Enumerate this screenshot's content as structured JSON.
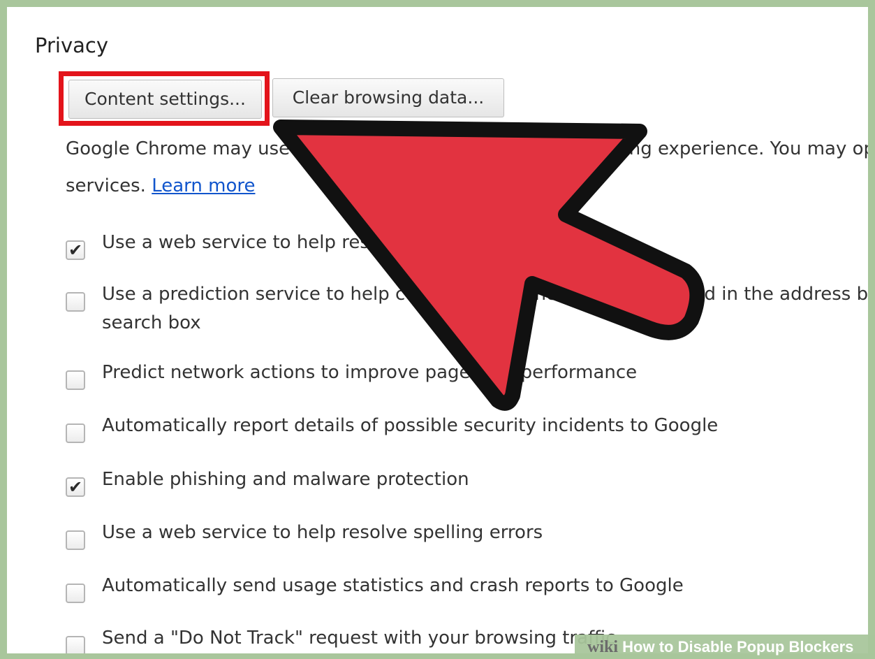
{
  "privacy": {
    "title": "Privacy",
    "buttons": {
      "content_settings": "Content settings...",
      "clear_browsing_data": "Clear browsing data..."
    },
    "description": {
      "line1": "Google Chrome may use web services to improve your browsing experience. You may op",
      "line2_prefix": "services.",
      "learn_more": "Learn more"
    },
    "checkboxes": [
      {
        "label": "Use a web service to help resolve navigation errors",
        "checked": true
      },
      {
        "label": "Use a prediction service to help complete searches and URLs typed in the address ba",
        "label2": "search box",
        "checked": false
      },
      {
        "label": "Predict network actions to improve page load performance",
        "checked": false
      },
      {
        "label": "Automatically report details of possible security incidents to Google",
        "checked": false
      },
      {
        "label": "Enable phishing and malware protection",
        "checked": true
      },
      {
        "label": "Use a web service to help resolve spelling errors",
        "checked": false
      },
      {
        "label": "Automatically send usage statistics and crash reports to Google",
        "checked": false
      },
      {
        "label": "Send a \"Do Not Track\" request with your browsing traffic",
        "checked": false
      }
    ]
  },
  "annotation": {
    "highlight_color": "#e3141b",
    "arrow_color": "#e23340",
    "arrow_outline": "#111111"
  },
  "watermark": {
    "logo": "wiki",
    "text": "How to Disable Popup Blockers"
  },
  "colors": {
    "frame": "#a9c69c",
    "link": "#1155cc"
  }
}
